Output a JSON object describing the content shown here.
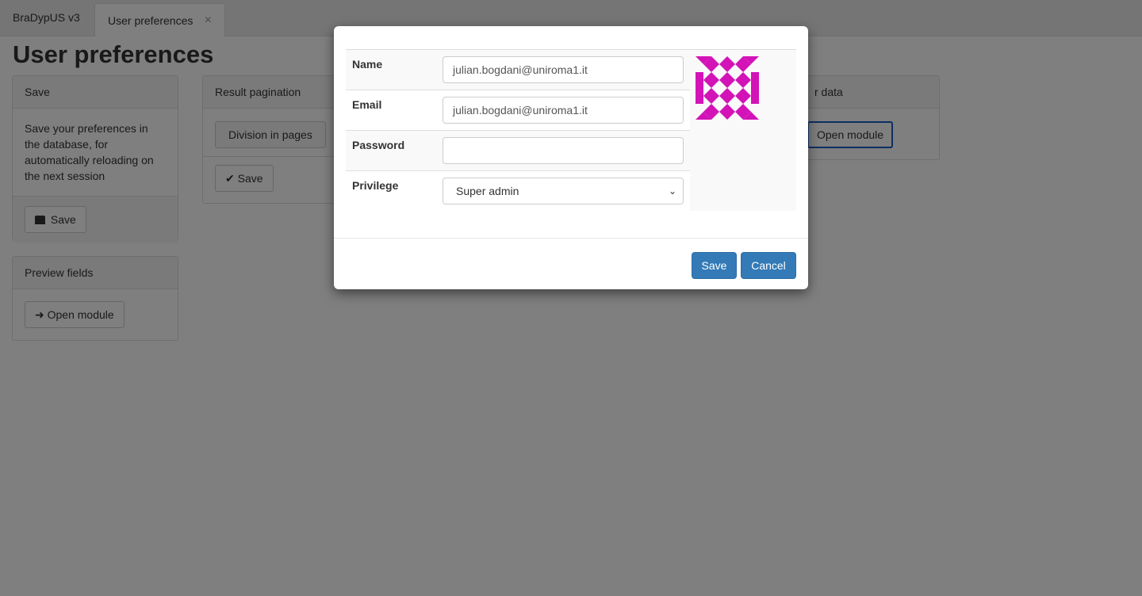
{
  "tabs": [
    {
      "label": "BraDypUS v3"
    },
    {
      "label": "User preferences",
      "close": "×"
    }
  ],
  "page": {
    "title": "User preferences"
  },
  "save_panel": {
    "title": "Save",
    "body": "Save your preferences in the database, for automatically reloading on the next session",
    "button": "Save",
    "button_icon": "hdd-icon"
  },
  "preview_panel": {
    "title": "Preview fields",
    "button": "Open module",
    "button_icon": "arrow-right-icon"
  },
  "pagination_panel": {
    "title": "Result pagination",
    "option": "Division in pages",
    "button": "Save",
    "button_icon": "check-icon"
  },
  "user_data_panel": {
    "title": "r data",
    "button": "Open module"
  },
  "modal": {
    "fields": {
      "name": {
        "label": "Name",
        "value": "julian.bogdani@uniroma1.it"
      },
      "email": {
        "label": "Email",
        "value": "julian.bogdani@uniroma1.it"
      },
      "password": {
        "label": "Password",
        "value": ""
      },
      "privilege": {
        "label": "Privilege",
        "value": "Super admin"
      }
    },
    "avatar_color": "#d313b8",
    "save_button": "Save",
    "cancel_button": "Cancel"
  },
  "colors": {
    "primary": "#337ab7",
    "overlay": "rgba(0,0,0,0.5)"
  }
}
